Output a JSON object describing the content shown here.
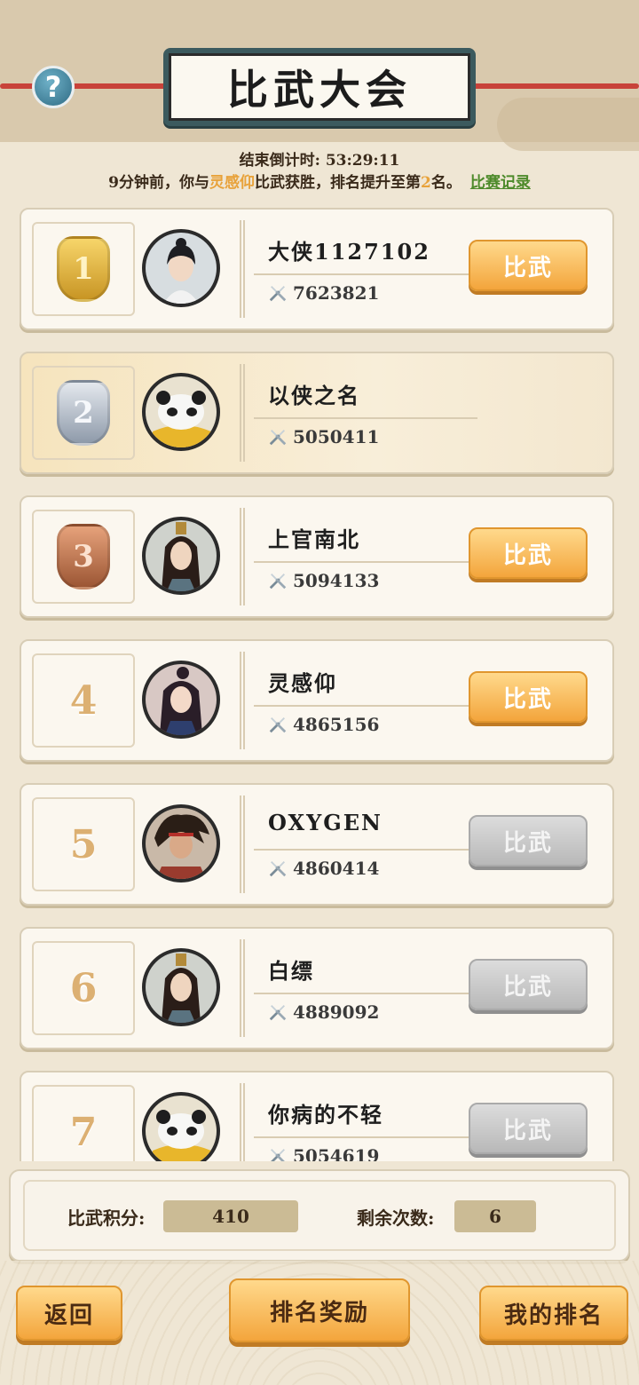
{
  "header": {
    "title": "比武大会",
    "help_label": "?"
  },
  "countdown": {
    "label": "结束倒计时:",
    "time": "53:29:11"
  },
  "notice": {
    "prefix": "9分钟前，你与",
    "opponent": "灵感仰",
    "middle": "比武获胜，排名提升至第",
    "rank": "2",
    "suffix": "名。",
    "record_link": "比赛记录"
  },
  "fight_label": "比武",
  "players": [
    {
      "rank": "1",
      "name": "大侠1127102",
      "power": "7623821",
      "medal": "gold",
      "button": "active",
      "avatar": "white-robe"
    },
    {
      "rank": "2",
      "name": "以侠之名",
      "power": "5050411",
      "medal": "silver",
      "button": "none",
      "avatar": "panda"
    },
    {
      "rank": "3",
      "name": "上官南北",
      "power": "5094133",
      "medal": "bronze",
      "button": "active",
      "avatar": "long-hair"
    },
    {
      "rank": "4",
      "name": "灵感仰",
      "power": "4865156",
      "medal": "none",
      "button": "active",
      "avatar": "lady"
    },
    {
      "rank": "5",
      "name": "OXYGEN",
      "power": "4860414",
      "medal": "none",
      "button": "disabled",
      "avatar": "warrior"
    },
    {
      "rank": "6",
      "name": "白缥",
      "power": "4889092",
      "medal": "none",
      "button": "disabled",
      "avatar": "long-hair"
    },
    {
      "rank": "7",
      "name": "你病的不轻",
      "power": "5054619",
      "medal": "none",
      "button": "disabled",
      "avatar": "panda"
    }
  ],
  "score": {
    "points_label": "比武积分:",
    "points_value": "410",
    "remaining_label": "剩余次数:",
    "remaining_value": "6"
  },
  "bottom": {
    "back": "返回",
    "rewards": "排名奖励",
    "my_rank": "我的排名"
  },
  "colors": {
    "accent_orange": "#f3a53c",
    "highlight": "#e8a23a",
    "link_green": "#4d8a2a",
    "disabled_gray": "#b8b8b8"
  }
}
